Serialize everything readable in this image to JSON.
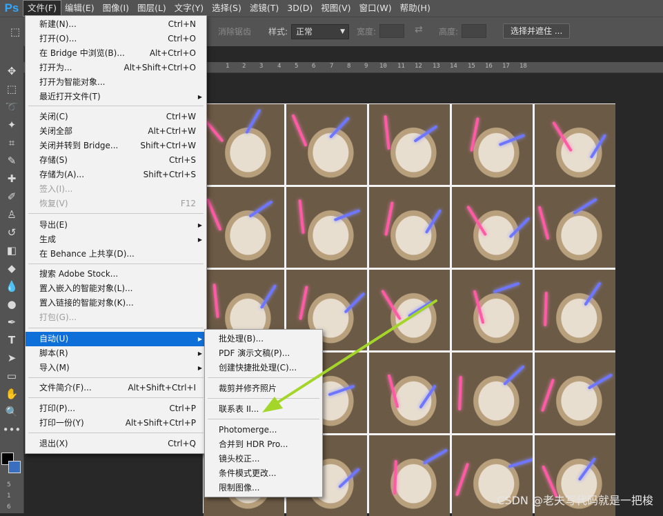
{
  "app": {
    "logo": "Ps"
  },
  "menubar": {
    "items": [
      "文件(F)",
      "编辑(E)",
      "图像(I)",
      "图层(L)",
      "文字(Y)",
      "选择(S)",
      "滤镜(T)",
      "3D(D)",
      "视图(V)",
      "窗口(W)",
      "帮助(H)"
    ]
  },
  "options": {
    "antialias_label": "消除锯齿",
    "style_label": "样式:",
    "style_value": "正常",
    "width_label": "宽度:",
    "height_label": "高度:",
    "select_mask_button": "选择并遮住 ..."
  },
  "ruler": {
    "top_ticks": [
      "1",
      "2",
      "3",
      "4",
      "5",
      "6",
      "7",
      "8",
      "9",
      "10",
      "11",
      "12",
      "13",
      "14",
      "15",
      "16",
      "17",
      "18"
    ],
    "left_ticks": [
      "5",
      "1",
      "6"
    ]
  },
  "file_menu": {
    "items": [
      {
        "label": "新建(N)...",
        "shortcut": "Ctrl+N"
      },
      {
        "label": "打开(O)...",
        "shortcut": "Ctrl+O"
      },
      {
        "label": "在 Bridge 中浏览(B)...",
        "shortcut": "Alt+Ctrl+O"
      },
      {
        "label": "打开为...",
        "shortcut": "Alt+Shift+Ctrl+O"
      },
      {
        "label": "打开为智能对象...",
        "shortcut": ""
      },
      {
        "label": "最近打开文件(T)",
        "shortcut": ""
      },
      {
        "label": "关闭(C)",
        "shortcut": "Ctrl+W"
      },
      {
        "label": "关闭全部",
        "shortcut": "Alt+Ctrl+W"
      },
      {
        "label": "关闭并转到 Bridge...",
        "shortcut": "Shift+Ctrl+W"
      },
      {
        "label": "存储(S)",
        "shortcut": "Ctrl+S"
      },
      {
        "label": "存储为(A)...",
        "shortcut": "Shift+Ctrl+S"
      },
      {
        "label": "签入(I)...",
        "shortcut": ""
      },
      {
        "label": "恢复(V)",
        "shortcut": "F12"
      },
      {
        "label": "导出(E)",
        "shortcut": ""
      },
      {
        "label": "生成",
        "shortcut": ""
      },
      {
        "label": "在 Behance 上共享(D)...",
        "shortcut": ""
      },
      {
        "label": "搜索 Adobe Stock...",
        "shortcut": ""
      },
      {
        "label": "置入嵌入的智能对象(L)...",
        "shortcut": ""
      },
      {
        "label": "置入链接的智能对象(K)...",
        "shortcut": ""
      },
      {
        "label": "打包(G)...",
        "shortcut": ""
      },
      {
        "label": "自动(U)",
        "shortcut": ""
      },
      {
        "label": "脚本(R)",
        "shortcut": ""
      },
      {
        "label": "导入(M)",
        "shortcut": ""
      },
      {
        "label": "文件简介(F)...",
        "shortcut": "Alt+Shift+Ctrl+I"
      },
      {
        "label": "打印(P)...",
        "shortcut": "Ctrl+P"
      },
      {
        "label": "打印一份(Y)",
        "shortcut": "Alt+Shift+Ctrl+P"
      },
      {
        "label": "退出(X)",
        "shortcut": "Ctrl+Q"
      }
    ]
  },
  "automate_submenu": {
    "items": [
      "批处理(B)...",
      "PDF 演示文稿(P)...",
      "创建快捷批处理(C)...",
      "裁剪并修齐照片",
      "联系表 II...",
      "Photomerge...",
      "合并到 HDR Pro...",
      "镜头校正...",
      "条件模式更改...",
      "限制图像..."
    ]
  },
  "annotation": {
    "arrow_color": "#a4d62a"
  },
  "colors": {
    "accent": "#0f6fd8",
    "ps_blue": "#31a8ff"
  },
  "watermark": "CSDN @老夫写代码就是一把梭"
}
